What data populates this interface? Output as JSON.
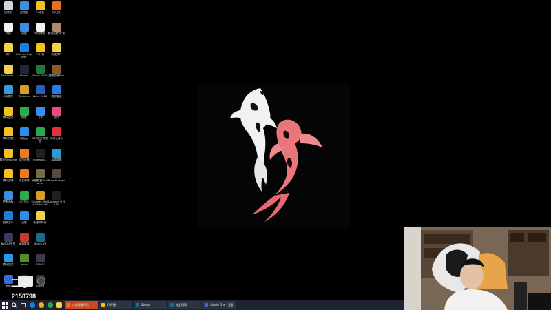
{
  "desktop": {
    "icons": [
      {
        "label": "回收站",
        "icon": "recycle-bin-icon",
        "color": "#cfd6dd"
      },
      {
        "label": "此电脑",
        "icon": "computer-icon",
        "color": "#3d8ee0"
      },
      {
        "label": "YY语音",
        "icon": "yy-icon",
        "color": "#f2c21b"
      },
      {
        "label": "向日葵",
        "icon": "sunflower-icon",
        "color": "#f26a1b"
      },
      {
        "label": "文档",
        "icon": "document-icon",
        "color": "#f4f4f4"
      },
      {
        "label": "网络",
        "icon": "network-icon",
        "color": "#3d8ee0"
      },
      {
        "label": "吃鸡辅助",
        "icon": "game-helper-icon",
        "color": "#f2f2f2"
      },
      {
        "label": "梦幻西游 PC版",
        "icon": "game-client-icon",
        "color": "#b08a6a"
      },
      {
        "label": "文件",
        "icon": "folder-icon",
        "color": "#f2d24a"
      },
      {
        "label": "Internet Explorer",
        "icon": "ie-icon",
        "color": "#1a7fd6"
      },
      {
        "label": "YY开播",
        "icon": "yy-live-icon",
        "color": "#f2c21b"
      },
      {
        "label": "新建文件",
        "icon": "new-file-icon",
        "color": "#f2d24a"
      },
      {
        "label": "Administr...",
        "icon": "user-folder-icon",
        "color": "#f2d24a"
      },
      {
        "label": "Steam",
        "icon": "steam-icon",
        "color": "#1b2838"
      },
      {
        "label": "Excel 2010",
        "icon": "excel-icon",
        "color": "#1e7a3c"
      },
      {
        "label": "魔兽世界Mini",
        "icon": "wow-icon",
        "color": "#8a5a2a"
      },
      {
        "label": "QQ游戏",
        "icon": "qq-game-icon",
        "color": "#3a9ae0"
      },
      {
        "label": "WeGame",
        "icon": "wegame-icon",
        "color": "#d8a020"
      },
      {
        "label": "Word 2010",
        "icon": "word-icon",
        "color": "#2a5cb8"
      },
      {
        "label": "电脑管家",
        "icon": "pc-manager-icon",
        "color": "#2a7ae8"
      },
      {
        "label": "腾讯会议",
        "icon": "meeting-icon",
        "color": "#f2c21b"
      },
      {
        "label": "微信",
        "icon": "wechat-icon",
        "color": "#2bae4a"
      },
      {
        "label": "飞书",
        "icon": "feishu-icon",
        "color": "#3a8ef0"
      },
      {
        "label": "照片",
        "icon": "photos-icon",
        "color": "#e84a8a"
      },
      {
        "label": "腾讯视频",
        "icon": "tencent-video-icon",
        "color": "#f2c21b"
      },
      {
        "label": "网易云",
        "icon": "netease-icon",
        "color": "#2a8ef0"
      },
      {
        "label": "360安全浏览器",
        "icon": "browser-360-icon",
        "color": "#2aa84a"
      },
      {
        "label": "网易云音乐",
        "icon": "netease-music-icon",
        "color": "#e8303a"
      },
      {
        "label": "腾讯WeGame",
        "icon": "tencent-wegame-icon",
        "color": "#f2c21b"
      },
      {
        "label": "斗鱼直播",
        "icon": "douyu-icon",
        "color": "#f27a1b"
      },
      {
        "label": "screenpr...",
        "icon": "screen-recorder-icon",
        "color": "#202020"
      },
      {
        "label": "英雄联盟",
        "icon": "lol-icon",
        "color": "#2a9ad8"
      },
      {
        "label": "腾讯游戏",
        "icon": "tencent-game-icon",
        "color": "#f2c21b"
      },
      {
        "label": "斗鱼游戏",
        "icon": "douyu-game-icon",
        "color": "#f27a1b"
      },
      {
        "label": "英雄联盟WeGame",
        "icon": "lol-wegame-icon",
        "color": "#7a6a4a"
      },
      {
        "label": "Dread Hunger",
        "icon": "dread-hunger-icon",
        "color": "#5a4a3a"
      },
      {
        "label": "控制面板",
        "icon": "control-panel-icon",
        "color": "#3a8ee0"
      },
      {
        "label": "QQ音乐",
        "icon": "qq-music-icon",
        "color": "#2bae4a"
      },
      {
        "label": "Counter-Strike Global Off...",
        "icon": "csgo-icon",
        "color": "#d8a020"
      },
      {
        "label": "Logitech G HUB",
        "icon": "logitech-icon",
        "color": "#202020"
      },
      {
        "label": "酷狗音乐",
        "icon": "kugou-icon",
        "color": "#1a7fd6"
      },
      {
        "label": "迅雷",
        "icon": "xunlei-icon",
        "color": "#2a8ef0"
      },
      {
        "label": "新建文件夹",
        "icon": "folder-icon",
        "color": "#f2d24a"
      },
      {
        "label": "",
        "icon": "",
        "color": ""
      },
      {
        "label": "NVIDIA平台",
        "icon": "nvidia-icon",
        "color": "#3a3a5a"
      },
      {
        "label": "英雄联盟",
        "icon": "lol-client-icon",
        "color": "#c83a2a"
      },
      {
        "label": "Steam VR",
        "icon": "steam-vr-icon",
        "color": "#1b6a8a"
      },
      {
        "label": "",
        "icon": "",
        "color": ""
      },
      {
        "label": "腾讯应用",
        "icon": "tencent-app-icon",
        "color": "#2a9ae8"
      },
      {
        "label": "Remo",
        "icon": "remo-icon",
        "color": "#5a8a2a"
      },
      {
        "label": "GTAVV",
        "icon": "gta-icon",
        "color": "#3a3a4a"
      },
      {
        "label": "",
        "icon": "",
        "color": ""
      },
      {
        "label": "直播",
        "icon": "live-icon",
        "color": "#3a6ad8"
      },
      {
        "label": "OBS",
        "icon": "obs-icon",
        "color": "#303030"
      },
      {
        "label": "Studio",
        "icon": "studio-icon",
        "color": "#303030"
      }
    ]
  },
  "overlay": {
    "viewer_count": "2158798",
    "badge_glyphs": "二伊"
  },
  "taskbar": {
    "tasks": [
      {
        "label": "斗鱼直播伴侣",
        "color": "#f27a1b",
        "active": true
      },
      {
        "label": "YY开播",
        "color": "#f2c21b",
        "active": false
      },
      {
        "label": "Steam",
        "color": "#1b6a8a",
        "active": false
      },
      {
        "label": "好友列表",
        "color": "#1b6a8a",
        "active": false
      },
      {
        "label": "Studio One - 无题",
        "color": "#3a6ad8",
        "active": false
      }
    ]
  }
}
